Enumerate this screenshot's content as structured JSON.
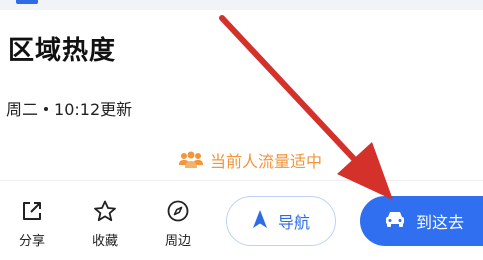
{
  "page": {
    "section_title": "区域热度",
    "update_day": "周二",
    "update_time": "10:12更新",
    "crowd_status": "当前人流量适中"
  },
  "actions": {
    "share": "分享",
    "favorite": "收藏",
    "nearby": "周边"
  },
  "buttons": {
    "navigate": "导航",
    "go_here": "到这去"
  },
  "icons": {
    "share": "share-icon",
    "favorite": "star-icon",
    "nearby": "compass-icon",
    "navigate": "navigation-arrow-icon",
    "go_here": "car-icon",
    "crowd": "people-icon"
  },
  "colors": {
    "primary": "#2f6ff0",
    "crowd": "#f1963a",
    "annotation_arrow": "#d3312a"
  }
}
